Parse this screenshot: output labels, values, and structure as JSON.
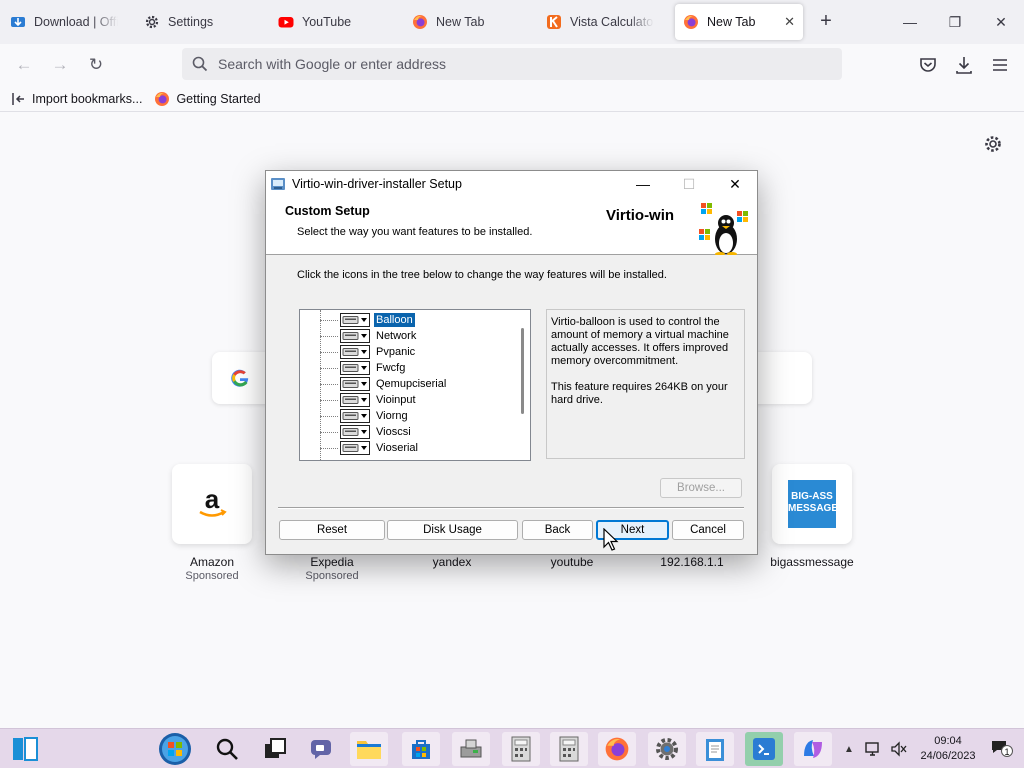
{
  "browser": {
    "tabs": [
      {
        "title": "Download | Office",
        "icon": "office-download-icon",
        "active": false
      },
      {
        "title": "Settings",
        "icon": "gear-icon",
        "active": false
      },
      {
        "title": "YouTube",
        "icon": "youtube-icon",
        "active": false
      },
      {
        "title": "New Tab",
        "icon": "firefox-icon",
        "active": false
      },
      {
        "title": "Vista Calculator - ",
        "icon": "vista-calculator-icon",
        "active": false
      },
      {
        "title": "New Tab",
        "icon": "firefox-icon",
        "active": true
      }
    ],
    "search_placeholder": "Search with Google or enter address",
    "bookmarks": [
      {
        "label": "Import bookmarks...",
        "icon": "import-icon"
      },
      {
        "label": "Getting Started",
        "icon": "firefox-icon"
      }
    ]
  },
  "newtab": {
    "shortcuts": [
      {
        "label": "Amazon",
        "sub": "Sponsored",
        "icon": "amazon-icon"
      },
      {
        "label": "Expedia",
        "sub": "Sponsored",
        "icon": "expedia-icon"
      },
      {
        "label": "yandex",
        "sub": "",
        "icon": "yandex-icon"
      },
      {
        "label": "youtube",
        "sub": "",
        "icon": "youtube-icon"
      },
      {
        "label": "192.168.1.1",
        "sub": "",
        "icon": "network-icon"
      },
      {
        "label": "bigassmessage",
        "sub": "",
        "icon": "bigassmessage-icon",
        "tile_text": "BIG-ASS MESSAGE"
      }
    ]
  },
  "dialog": {
    "title": "Virtio-win-driver-installer Setup",
    "header_title": "Custom Setup",
    "header_desc": "Select the way you want features to be installed.",
    "brand": "Virtio-win",
    "instruction": "Click the icons in the tree below to change the way features will be installed.",
    "features": [
      "Balloon",
      "Network",
      "Pvpanic",
      "Fwcfg",
      "Qemupciserial",
      "Vioinput",
      "Viorng",
      "Vioscsi",
      "Vioserial"
    ],
    "selected_feature": "Balloon",
    "description": "Virtio-balloon is used to control the amount of memory a virtual machine actually accesses. It offers improved memory overcommitment.",
    "requirement": "This feature requires 264KB on your hard drive.",
    "buttons": {
      "browse": "Browse...",
      "reset": "Reset",
      "disk_usage": "Disk Usage",
      "back": "Back",
      "next": "Next",
      "cancel": "Cancel"
    }
  },
  "taskbar": {
    "apps": [
      "widgets-icon",
      "windows-start-icon",
      "search-icon",
      "task-view-icon",
      "teams-chat-icon",
      "file-explorer-icon",
      "microsoft-store-icon",
      "drive-icon",
      "calculator-icon",
      "calculator-icon",
      "firefox-icon",
      "settings-icon",
      "notepad-icon",
      "remote-desktop-icon",
      "copilot-icon"
    ],
    "time": "09:04",
    "date": "24/06/2023",
    "notification_count": "1"
  },
  "colors": {
    "accent": "#0078d4",
    "selection": "#0a64ad",
    "taskbar": "#e5d8ea"
  }
}
